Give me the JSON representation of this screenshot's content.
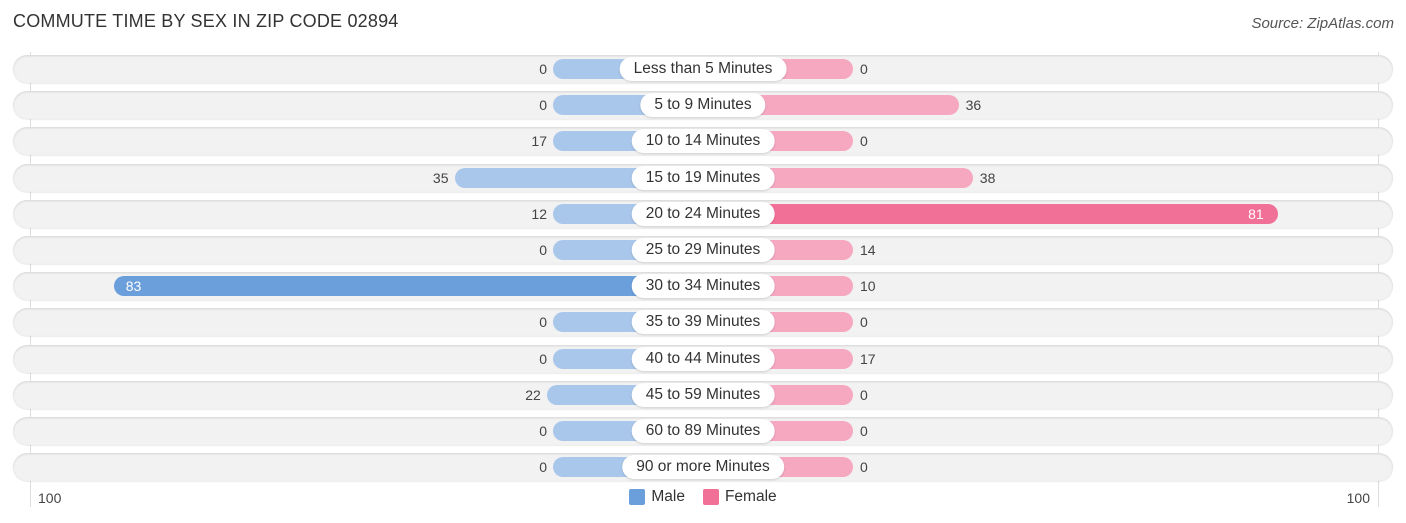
{
  "header": {
    "title": "COMMUTE TIME BY SEX IN ZIP CODE 02894",
    "source": "Source: ZipAtlas.com"
  },
  "colors": {
    "male": "#6a9fdb",
    "male_light": "#a9c7ea",
    "female": "#f07098",
    "female_light": "#f5a8c0"
  },
  "chart_data": {
    "type": "bar",
    "orientation": "horizontal-diverging",
    "title": "COMMUTE TIME BY SEX IN ZIP CODE 02894",
    "categories": [
      "Less than 5 Minutes",
      "5 to 9 Minutes",
      "10 to 14 Minutes",
      "15 to 19 Minutes",
      "20 to 24 Minutes",
      "25 to 29 Minutes",
      "30 to 34 Minutes",
      "35 to 39 Minutes",
      "40 to 44 Minutes",
      "45 to 59 Minutes",
      "60 to 89 Minutes",
      "90 or more Minutes"
    ],
    "series": [
      {
        "name": "Male",
        "values": [
          0,
          0,
          17,
          35,
          12,
          0,
          83,
          0,
          0,
          22,
          0,
          0
        ]
      },
      {
        "name": "Female",
        "values": [
          0,
          36,
          0,
          38,
          81,
          14,
          10,
          0,
          17,
          0,
          0,
          0
        ]
      }
    ],
    "xlim": [
      -100,
      100
    ],
    "axis_labels": {
      "left": "100",
      "right": "100"
    },
    "legend": {
      "position": "bottom-center",
      "entries": [
        "Male",
        "Female"
      ]
    }
  }
}
